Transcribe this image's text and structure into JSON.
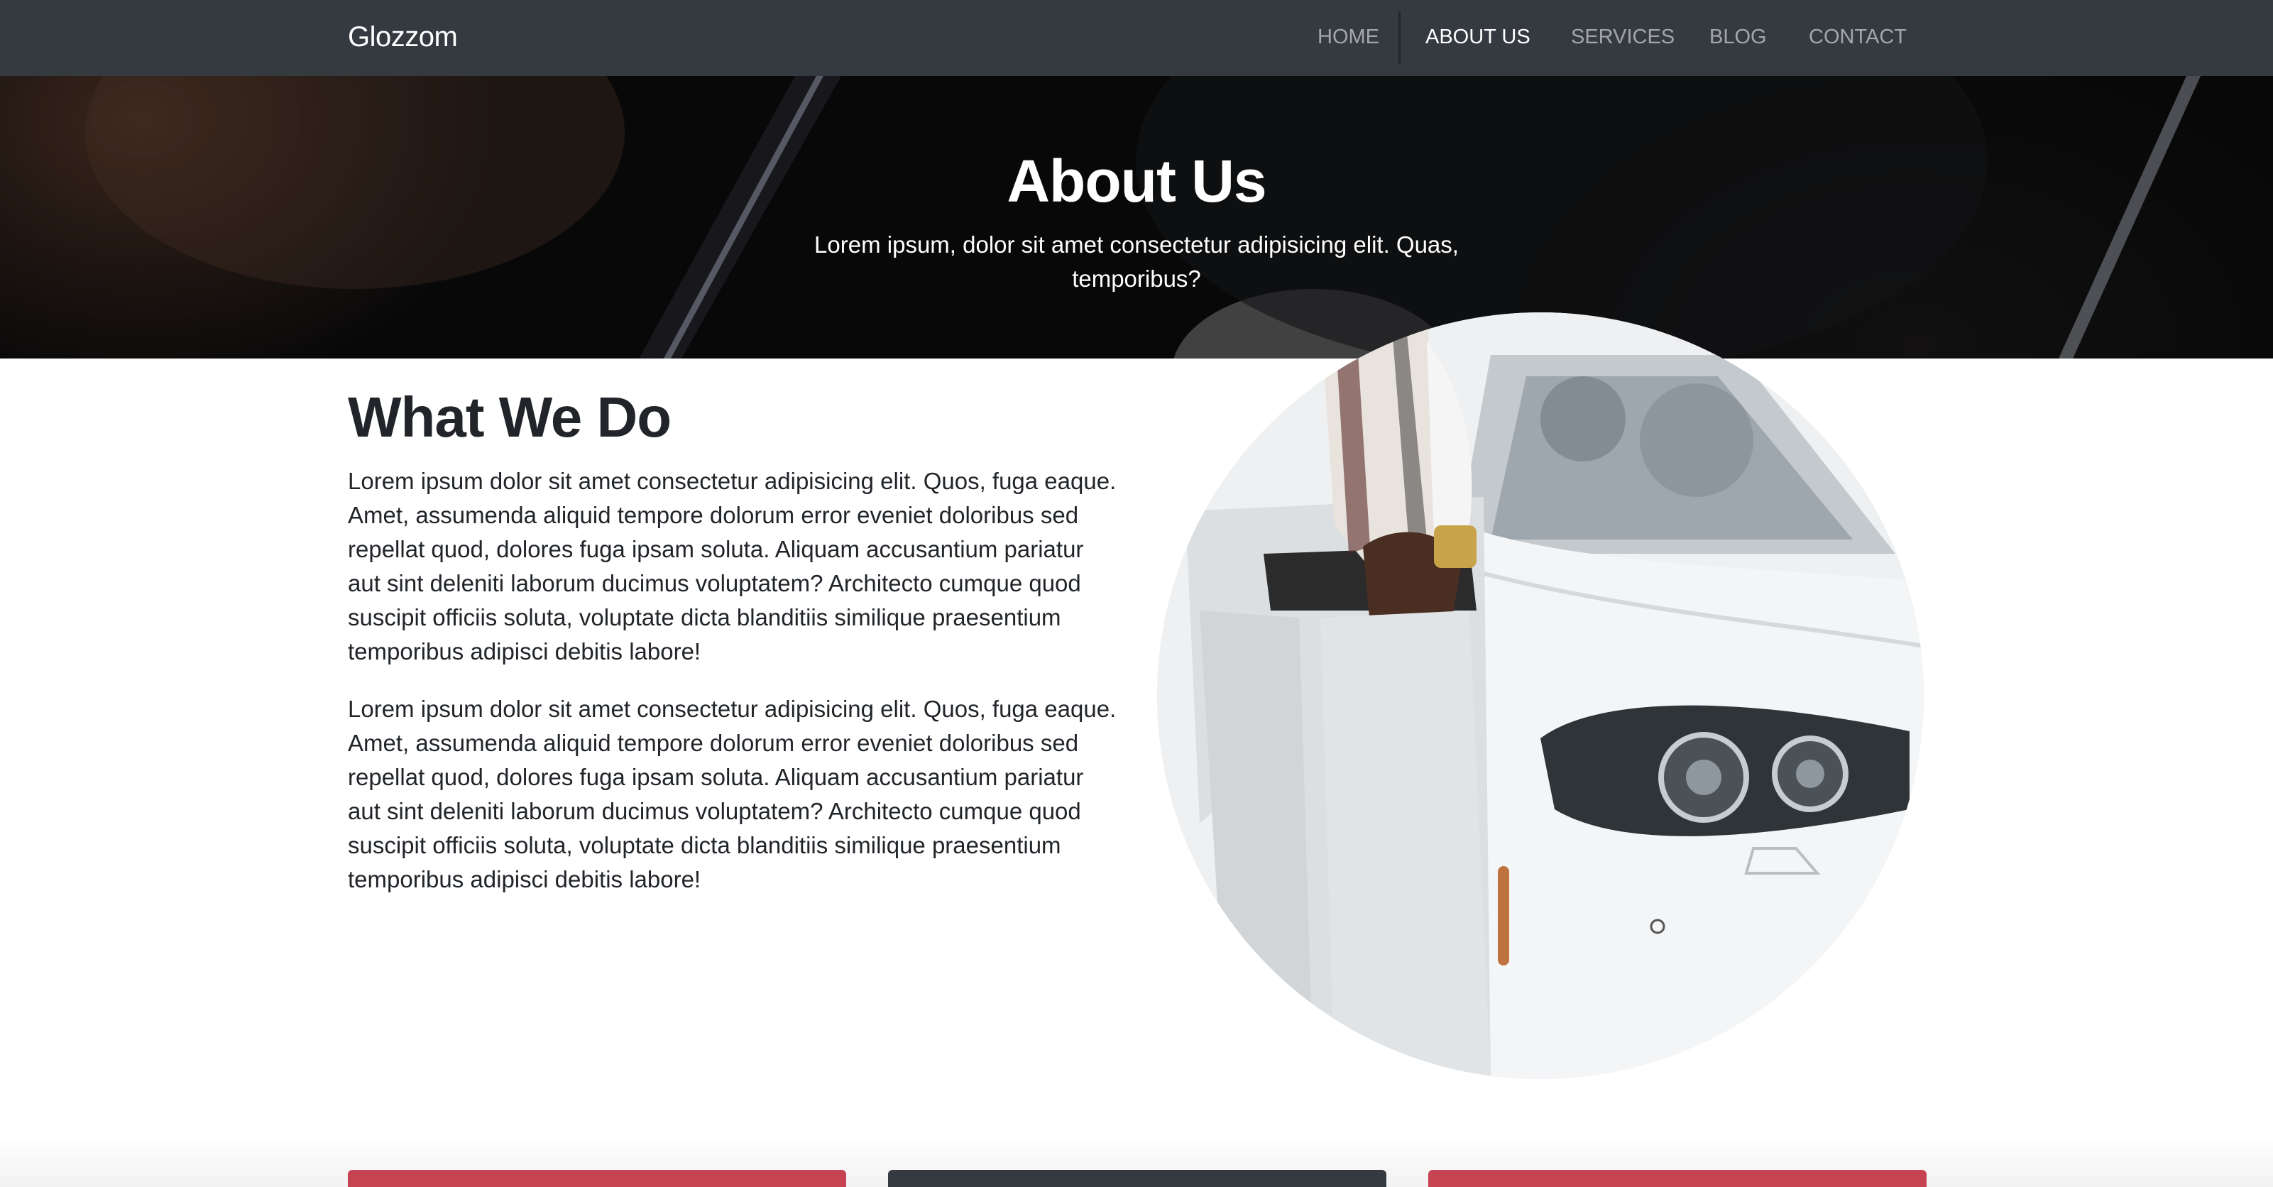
{
  "navbar": {
    "brand": "Glozzom",
    "items": [
      {
        "label": "HOME",
        "active": false
      },
      {
        "label": "ABOUT US",
        "active": true
      },
      {
        "label": "SERVICES",
        "active": false
      },
      {
        "label": "BLOG",
        "active": false
      },
      {
        "label": "CONTACT",
        "active": false
      }
    ]
  },
  "hero": {
    "title": "About Us",
    "subtitle": "Lorem ipsum, dolor sit amet consectetur adipisicing elit. Quas, temporibus?"
  },
  "about": {
    "heading": "What We Do",
    "paragraphs": [
      "Lorem ipsum dolor sit amet consectetur adipisicing elit. Quos, fuga eaque. Amet, assumenda aliquid tempore dolorum error eveniet doloribus sed repellat quod, dolores fuga ipsam soluta. Aliquam accusantium pariatur aut sint deleniti laborum ducimus voluptatem? Architecto cumque quod suscipit officiis soluta, voluptate dicta blanditiis similique praesentium temporibus adipisci debitis labore!",
      "Lorem ipsum dolor sit amet consectetur adipisicing elit. Quos, fuga eaque. Amet, assumenda aliquid tempore dolorum error eveniet doloribus sed repellat quod, dolores fuga ipsam soluta. Aliquam accusantium pariatur aut sint deleniti laborum ducimus voluptatem? Architecto cumque quod suscipit officiis soluta, voluptate dicta blanditiis similique praesentium temporibus adipisci debitis labore!"
    ]
  },
  "colors": {
    "navbar_bg": "#343a40",
    "accent_red": "#c64351",
    "dark": "#343a40",
    "text": "#212529"
  }
}
